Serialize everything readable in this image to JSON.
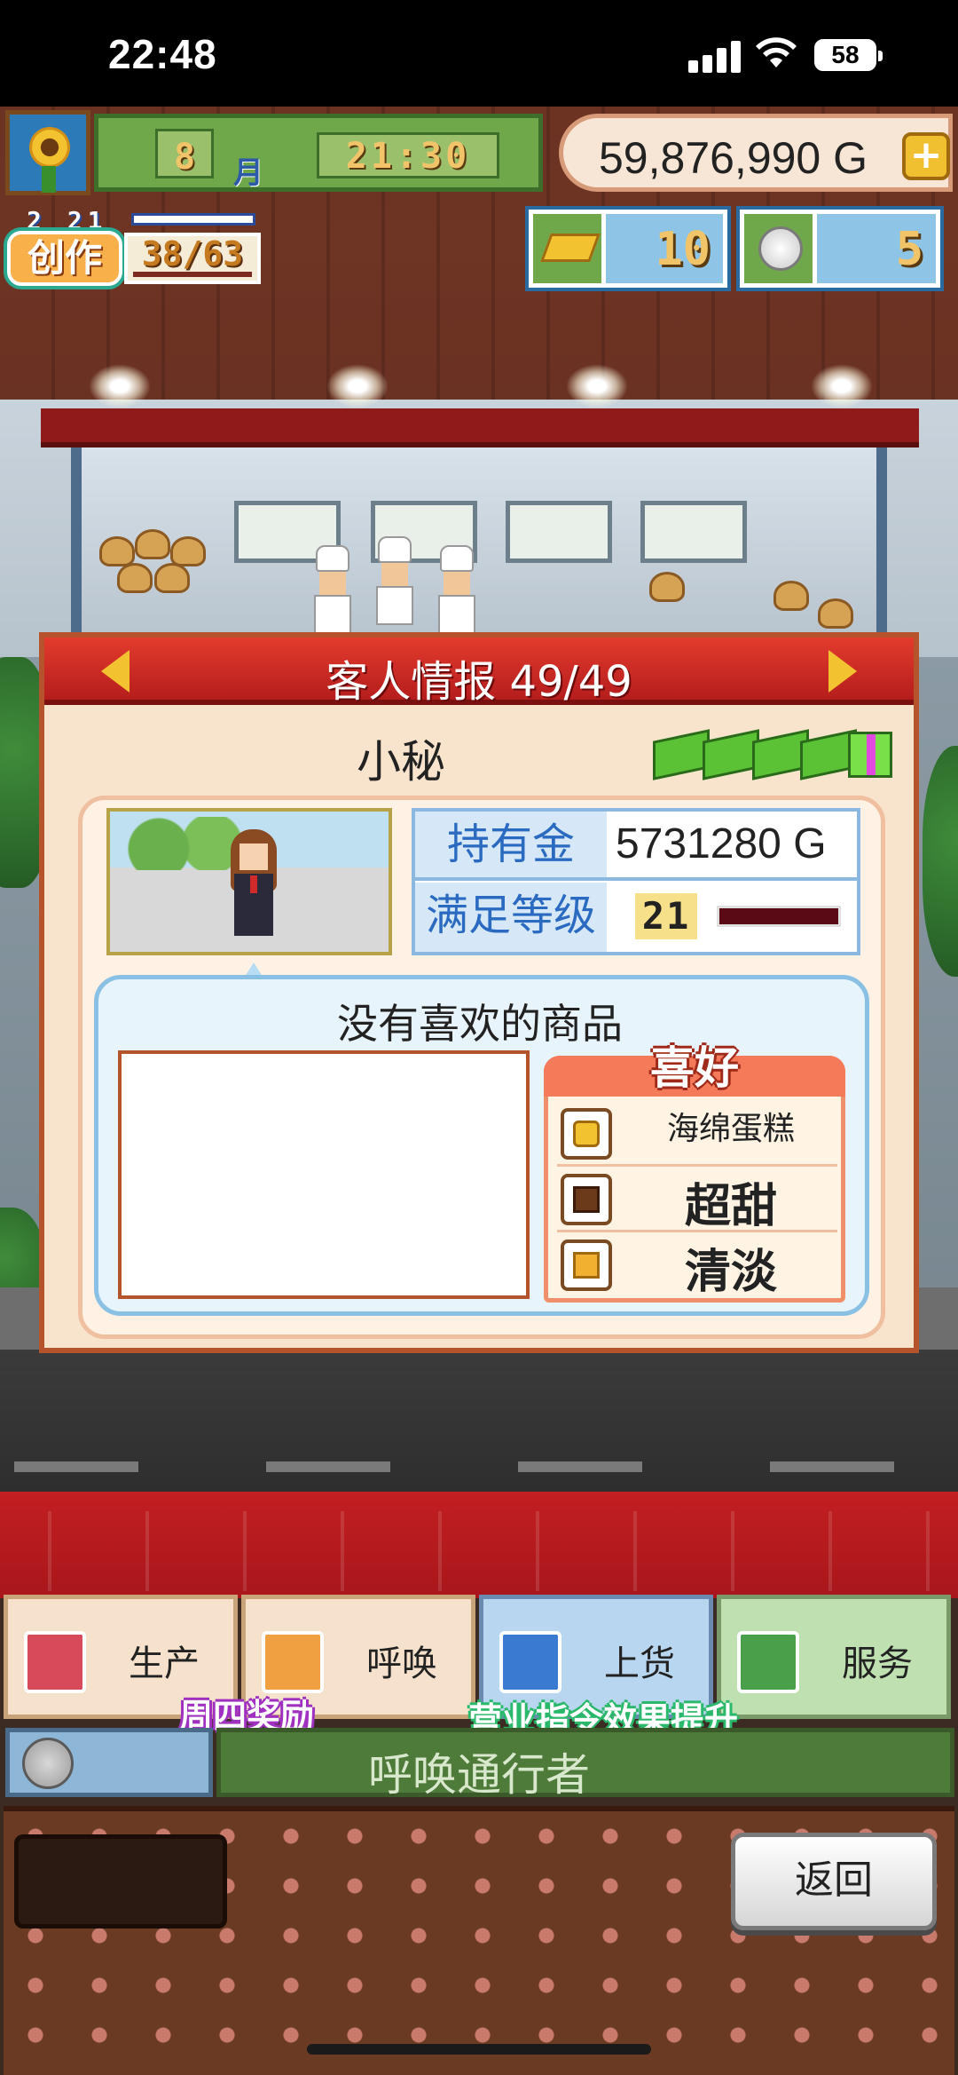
{
  "status_bar": {
    "time": "22:48",
    "battery": "58"
  },
  "hud": {
    "month": "8",
    "month_label": "月",
    "clock": "21:30",
    "money": "59,876,990 G",
    "create": {
      "date": "2 21",
      "label": "创作",
      "count": "38/63"
    },
    "gold_bars": "10",
    "coins": "5"
  },
  "dialog": {
    "title": "客人情报 49/49",
    "customer_name": "小秘",
    "info": [
      {
        "key": "持有金",
        "value": "5731280 G"
      },
      {
        "key": "满足等级",
        "value": "21"
      }
    ],
    "favorites_title": "没有喜欢的商品",
    "preferences": {
      "title": "喜好",
      "items": [
        {
          "label": "海绵蛋糕",
          "icon": "sponge-cake-icon"
        },
        {
          "label": "超甜",
          "icon": "chocolate-icon"
        },
        {
          "label": "清淡",
          "icon": "cube-icon"
        }
      ]
    }
  },
  "menu": {
    "buttons": [
      {
        "label": "生产",
        "icon": "produce-icon"
      },
      {
        "label": "呼唤",
        "icon": "call-icon"
      },
      {
        "label": "上货",
        "icon": "stock-icon"
      },
      {
        "label": "服务",
        "icon": "service-icon"
      }
    ],
    "tag_thursday": "周四奖励",
    "tag_business": "营业指令效果提升",
    "command_text": "呼唤通行者",
    "back_label": "返回"
  },
  "colors": {
    "dialog_header": "#c9231f",
    "pref_header": "#f47a5a",
    "command_bar": "#4e7a3a"
  }
}
